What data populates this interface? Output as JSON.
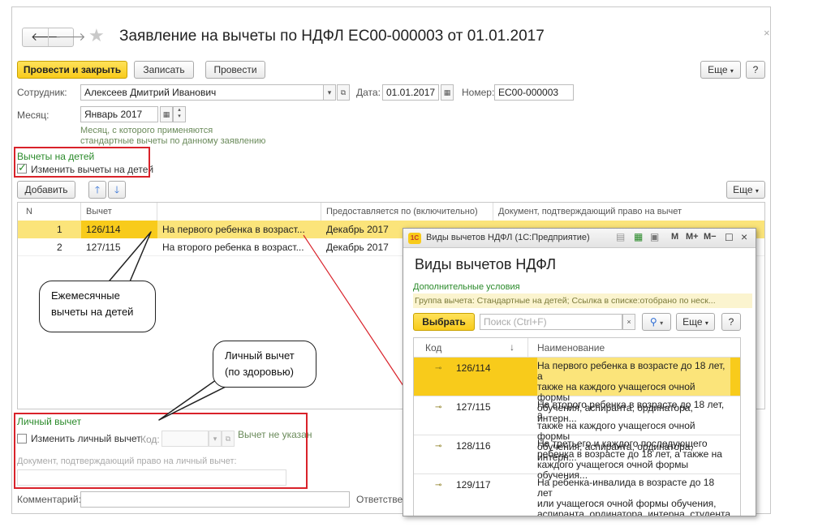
{
  "header": {
    "title": "Заявление на вычеты по НДФЛ ЕС00-000003 от 01.01.2017",
    "back_icon": "arrow-left-icon",
    "forward_icon": "arrow-right-icon",
    "favorite_icon": "star-icon",
    "close_icon": "close-icon"
  },
  "toolbar": {
    "post_close": "Провести и закрыть",
    "save": "Записать",
    "post": "Провести",
    "more": "Еще",
    "help": "?"
  },
  "form": {
    "employee_label": "Сотрудник:",
    "employee_value": "Алексеев Дмитрий Иванович",
    "date_label": "Дата:",
    "date_value": "01.01.2017",
    "number_label": "Номер:",
    "number_value": "ЕС00-000003",
    "month_label": "Месяц:",
    "month_value": "Январь 2017",
    "month_hint_1": "Месяц, с которого применяются",
    "month_hint_2": "стандартные вычеты по данному заявлению"
  },
  "children": {
    "section_title": "Вычеты на детей",
    "change_checkbox": "Изменить вычеты на детей",
    "add_button": "Добавить",
    "more": "Еще",
    "columns": {
      "n": "N",
      "deduction": "Вычет",
      "provided_until": "Предоставляется по (включительно)",
      "document": "Документ, подтверждающий право на вычет"
    },
    "rows": [
      {
        "n": "1",
        "code": "126/114",
        "desc": "На первого ребенка в возраст...",
        "until": "Декабрь 2017"
      },
      {
        "n": "2",
        "code": "127/115",
        "desc": "На второго ребенка в возраст...",
        "until": "Декабрь 2017"
      }
    ]
  },
  "personal": {
    "section_title": "Личный вычет",
    "change_checkbox": "Изменить личный вычет",
    "code_label": "Код:",
    "not_set": "Вычет не указан",
    "doc_label": "Документ, подтверждающий право на личный вычет:"
  },
  "footer": {
    "comment_label": "Комментарий:",
    "responsible_label": "Ответстве"
  },
  "callouts": {
    "monthly_1": "Ежемесячные",
    "monthly_2": "вычеты на детей",
    "personal_1": "Личный вычет",
    "personal_2": "(по здоровью)"
  },
  "popup": {
    "window_title": "Виды вычетов НДФЛ (1С:Предприятие)",
    "title_buttons": [
      "M",
      "M+",
      "M−"
    ],
    "heading": "Виды вычетов НДФЛ",
    "additional_label": "Дополнительные условия",
    "filter_text": "Группа вычета: Стандартные на детей; Ссылка в списке:отобрано по неск...",
    "select_button": "Выбрать",
    "search_placeholder": "Поиск (Ctrl+F)",
    "more": "Еще",
    "help": "?",
    "col_code": "Код",
    "col_name": "Наименование",
    "rows": [
      {
        "code": "126/114",
        "l1": "На первого ребенка в возрасте до 18 лет, а",
        "l2": "также на каждого учащегося очной формы",
        "l3": "обучения, аспиранта, ординатора, интерн..."
      },
      {
        "code": "127/115",
        "l1": "На второго ребенка в возрасте до 18 лет, а",
        "l2": "также на каждого учащегося очной формы",
        "l3": "обучения, аспиранта, ординатора, интерн..."
      },
      {
        "code": "128/116",
        "l1": "На третьего и каждого последующего",
        "l2": "ребенка в возрасте до 18 лет, а также на",
        "l3": "каждого учащегося очной формы обучения..."
      },
      {
        "code": "129/117",
        "l1": "На ребенка-инвалида в возрасте до 18 лет",
        "l2": "или учащегося очной формы обучения,",
        "l3": "аспиранта, ординатора, интерна, студента в"
      }
    ]
  },
  "colors": {
    "accent_yellow": "#f8cb1b",
    "selected_row": "#fbe47a",
    "annotation_red": "#d9222a",
    "group_green": "#2a8a2a"
  }
}
